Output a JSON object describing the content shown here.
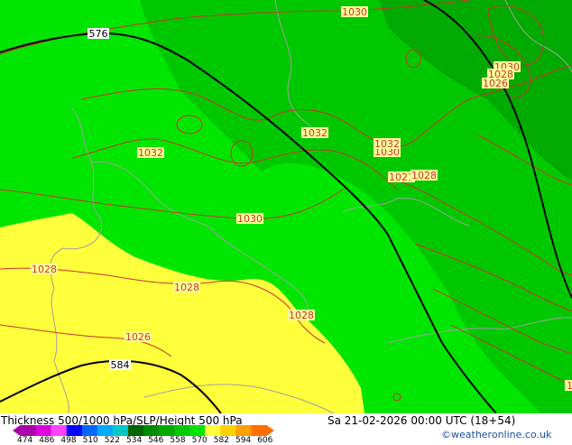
{
  "title": "Thickness 500/1000 hPa/SLP/Height 500 hPa",
  "valid_time": "Sa 21-02-2026 00:00 UTC (18+54)",
  "credit": "©weatheronline.co.uk",
  "colors": {
    "bright_green": "#00e600",
    "mid_green": "#00c800",
    "dark_green": "#00aa00",
    "yellow": "#ffff3c",
    "contour_red": "#cc3333",
    "coast_gray": "#a0a0a0",
    "height_line": "#000000"
  },
  "legend": {
    "ticks": [
      "474",
      "486",
      "498",
      "510",
      "522",
      "534",
      "546",
      "558",
      "570",
      "582",
      "594",
      "606"
    ],
    "colors": [
      "#aa00aa",
      "#dd00dd",
      "#ff44ff",
      "#0000ff",
      "#0066ff",
      "#00aaff",
      "#00c8c8",
      "#006400",
      "#008c00",
      "#00aa00",
      "#00c800",
      "#00e600",
      "#ffff3c",
      "#ffd200",
      "#ffa000",
      "#ff6e00"
    ]
  },
  "labels": {
    "h576": "576",
    "h584": "584",
    "p1030_top": "1030",
    "p1030_ne": "1030",
    "p1028_ne": "1028",
    "p1026_ne": "1026",
    "p1032_center": "1032",
    "p1032_east": "1032",
    "p1030_east": "1030",
    "p1032_west": "1032",
    "p1021": "1021",
    "p1028_east": "1028",
    "p1030_mid": "1030",
    "p1028_w": "1028",
    "p1028_sw": "1028",
    "p1028_s": "1028",
    "p1026_sw": "1026",
    "p1_edge": "1"
  }
}
